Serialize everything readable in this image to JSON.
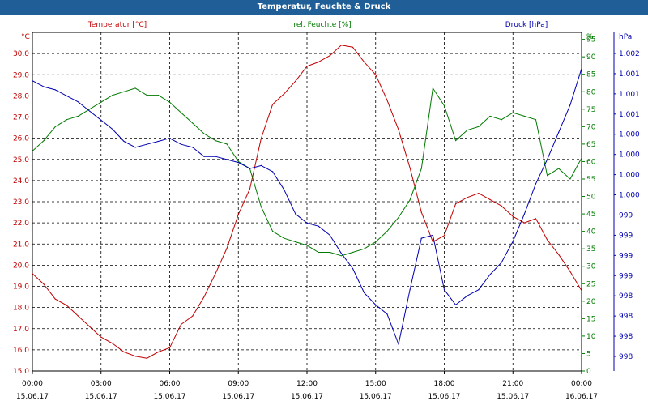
{
  "window": {
    "title": "Temperatur, Feuchte & Druck"
  },
  "colors": {
    "temperature": "#c00000",
    "humidity": "#007a00",
    "pressure": "#0000b0",
    "titlebar": "#1f5e96"
  },
  "chart_data": {
    "type": "line",
    "title": "Temperatur, Feuchte & Druck",
    "grid": true,
    "x_range": [
      "15.06.17 00:00",
      "16.06.17 00:00"
    ],
    "x_ticks": [
      {
        "time": "00:00",
        "date": "15.06.17",
        "h": 0
      },
      {
        "time": "03:00",
        "date": "15.06.17",
        "h": 3
      },
      {
        "time": "06:00",
        "date": "15.06.17",
        "h": 6
      },
      {
        "time": "09:00",
        "date": "15.06.17",
        "h": 9
      },
      {
        "time": "12:00",
        "date": "15.06.17",
        "h": 12
      },
      {
        "time": "15:00",
        "date": "15.06.17",
        "h": 15
      },
      {
        "time": "18:00",
        "date": "15.06.17",
        "h": 18
      },
      {
        "time": "21:00",
        "date": "15.06.17",
        "h": 21
      },
      {
        "time": "00:00",
        "date": "16.06.17",
        "h": 24
      }
    ],
    "axes": {
      "temperature": {
        "label": "Temperatur [°C]",
        "unit": "°C",
        "ylim": [
          15.0,
          31.0
        ],
        "ticks": [
          "30.0",
          "29.0",
          "28.0",
          "27.0",
          "26.0",
          "25.0",
          "24.0",
          "23.0",
          "22.0",
          "21.0",
          "20.0",
          "19.0",
          "18.0",
          "17.0",
          "16.0",
          "15.0"
        ],
        "tick_values": [
          30,
          29,
          28,
          27,
          26,
          25,
          24,
          23,
          22,
          21,
          20,
          19,
          18,
          17,
          16,
          15
        ]
      },
      "humidity": {
        "label": "rel. Feuchte [%]",
        "unit": "%",
        "ylim": [
          0,
          97
        ],
        "ticks": [
          "95",
          "90",
          "85",
          "80",
          "75",
          "70",
          "65",
          "60",
          "55",
          "50",
          "45",
          "40",
          "35",
          "30",
          "25",
          "20",
          "15",
          "10",
          "5",
          "0"
        ],
        "tick_values": [
          95,
          90,
          85,
          80,
          75,
          70,
          65,
          60,
          55,
          50,
          45,
          40,
          35,
          30,
          25,
          20,
          15,
          10,
          5,
          0
        ]
      },
      "pressure": {
        "label": "Druck [hPa]",
        "unit": "hPa",
        "ticks": [
          "1.002",
          "1.001",
          "1.001",
          "1.001",
          "1.000",
          "1.000",
          "1.000",
          "1.000",
          "999",
          "999",
          "999",
          "999",
          "998",
          "998",
          "998",
          "998"
        ]
      }
    },
    "series": [
      {
        "name": "Temperatur [°C]",
        "axis": "temperature",
        "x": [
          0,
          0.5,
          1,
          1.5,
          2,
          2.5,
          3,
          3.5,
          4,
          4.5,
          5,
          5.5,
          6,
          6.5,
          7,
          7.5,
          8,
          8.5,
          9,
          9.5,
          10,
          10.5,
          11,
          11.5,
          12,
          12.5,
          13,
          13.5,
          14,
          14.5,
          15,
          15.5,
          16,
          16.5,
          17,
          17.5,
          18,
          18.5,
          19,
          19.5,
          20,
          20.5,
          21,
          21.5,
          22,
          22.5,
          23,
          23.5,
          24
        ],
        "values": [
          19.6,
          19.1,
          18.4,
          18.1,
          17.6,
          17.1,
          16.6,
          16.3,
          15.9,
          15.7,
          15.6,
          15.9,
          16.1,
          17.2,
          17.6,
          18.5,
          19.6,
          20.8,
          22.4,
          23.6,
          26.0,
          27.6,
          28.1,
          28.7,
          29.4,
          29.6,
          29.9,
          30.4,
          30.3,
          29.6,
          29.0,
          27.8,
          26.4,
          24.6,
          22.5,
          21.1,
          21.4,
          22.9,
          23.2,
          23.4,
          23.1,
          22.8,
          22.3,
          22.0,
          22.2,
          21.2,
          20.5,
          19.7,
          18.8
        ]
      },
      {
        "name": "rel. Feuchte [%]",
        "axis": "humidity",
        "x": [
          0,
          0.5,
          1,
          1.5,
          2,
          2.5,
          3,
          3.5,
          4,
          4.5,
          5,
          5.5,
          6,
          6.5,
          7,
          7.5,
          8,
          8.5,
          9,
          9.5,
          10,
          10.5,
          11,
          11.5,
          12,
          12.5,
          13,
          13.5,
          14,
          14.5,
          15,
          15.5,
          16,
          16.5,
          17,
          17.5,
          18,
          18.5,
          19,
          19.5,
          20,
          20.5,
          21,
          21.5,
          22,
          22.5,
          23,
          23.5,
          24
        ],
        "values": [
          63,
          66,
          70,
          72,
          73,
          75,
          77,
          79,
          80,
          81,
          79,
          79,
          77,
          74,
          71,
          68,
          66,
          65,
          60,
          58,
          47,
          40,
          38,
          37,
          36,
          34,
          34,
          33,
          34,
          35,
          37,
          40,
          44,
          49,
          58,
          81,
          76,
          66,
          69,
          70,
          73,
          72,
          74,
          73,
          72,
          56,
          58,
          55,
          61
        ]
      },
      {
        "name": "Druck [hPa]",
        "axis": "pressure",
        "x": [
          0,
          0.5,
          1,
          1.5,
          2,
          2.5,
          3,
          3.5,
          4,
          4.5,
          5,
          5.5,
          6,
          6.5,
          7,
          7.5,
          8,
          8.5,
          9,
          9.5,
          10,
          10.5,
          11,
          11.5,
          12,
          12.5,
          13,
          13.5,
          14,
          14.5,
          15,
          15.5,
          16,
          16.5,
          17,
          17.5,
          18,
          18.5,
          19,
          19.5,
          20,
          20.5,
          21,
          21.5,
          22,
          22.5,
          23,
          23.5,
          24
        ],
        "values": [
          91,
          89,
          88,
          86,
          84,
          81,
          78,
          75,
          71,
          69,
          70,
          71,
          72,
          70,
          69,
          66,
          66,
          65,
          64,
          62,
          63,
          61,
          55,
          47,
          44,
          43,
          40,
          34,
          29,
          21,
          17,
          14,
          4,
          22,
          39,
          40,
          22,
          17,
          20,
          22,
          27,
          31,
          38,
          47,
          57,
          65,
          74,
          83,
          95
        ],
        "note_values": "plotted on an uncalibrated scale matching the right-hand axis ticks"
      }
    ]
  }
}
